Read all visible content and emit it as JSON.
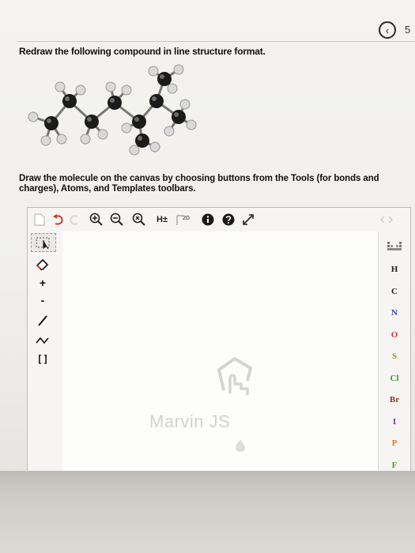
{
  "nav": {
    "back_icon": "chevron-left-icon",
    "back_glyph": "‹",
    "page": "5"
  },
  "question": {
    "instruction": "Redraw the following compound in line structure format.",
    "draw_instruction": "Draw the molecule on the canvas by choosing buttons from the Tools (for bonds and charges), Atoms, and Templates toolbars."
  },
  "editor": {
    "watermark": "Marvin JS",
    "top_tools": [
      {
        "icon": "new-document-icon"
      },
      {
        "icon": "undo-icon"
      },
      {
        "icon": "redo-icon"
      },
      {
        "icon": "zoom-in-icon"
      },
      {
        "icon": "zoom-out-icon"
      },
      {
        "icon": "zoom-reset-icon"
      },
      {
        "icon": "hydrogens-toggle-icon",
        "label": "H±"
      },
      {
        "icon": "2d-clean-icon",
        "label": "2D"
      },
      {
        "icon": "info-icon"
      },
      {
        "icon": "help-icon"
      },
      {
        "icon": "fullscreen-icon"
      }
    ],
    "left_tools": [
      {
        "icon": "selection-tool-icon"
      },
      {
        "icon": "eraser-icon"
      },
      {
        "icon": "charge-plus-icon",
        "label": "+"
      },
      {
        "icon": "charge-minus-icon",
        "label": "-"
      },
      {
        "icon": "single-bond-icon"
      },
      {
        "icon": "chain-icon"
      },
      {
        "icon": "template-bracket-icon",
        "label": "[ ]"
      }
    ],
    "atoms": [
      {
        "symbol": "H",
        "color": "#222222"
      },
      {
        "symbol": "C",
        "color": "#222222"
      },
      {
        "symbol": "N",
        "color": "#2f3fb8"
      },
      {
        "symbol": "O",
        "color": "#d9342b"
      },
      {
        "symbol": "S",
        "color": "#b58a1a"
      },
      {
        "symbol": "Cl",
        "color": "#2f9a2f"
      },
      {
        "symbol": "Br",
        "color": "#8a3a1a"
      },
      {
        "symbol": "I",
        "color": "#8a2aa0"
      },
      {
        "symbol": "P",
        "color": "#e07a1a"
      },
      {
        "symbol": "F",
        "color": "#5aa02a"
      }
    ]
  },
  "colors": {
    "text": "#111111",
    "carbon": "#1b1b1b",
    "hydrogen": "#d8d8d8"
  }
}
